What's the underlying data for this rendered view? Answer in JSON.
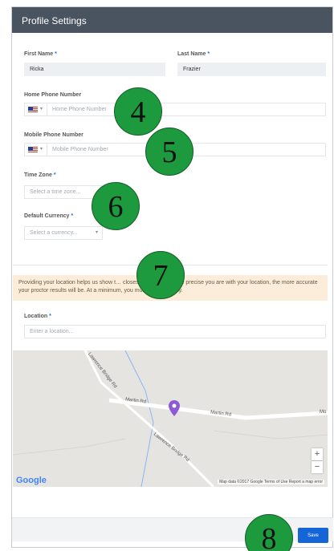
{
  "header": {
    "title": "Profile Settings"
  },
  "required_mark": "*",
  "form": {
    "first_name": {
      "label": "First Name",
      "value": "Ricka"
    },
    "last_name": {
      "label": "Last Name",
      "value": "Frazier"
    },
    "home_phone": {
      "label": "Home Phone Number",
      "placeholder": "Home Phone Number"
    },
    "mobile_phone": {
      "label": "Mobile Phone Number",
      "placeholder": "Mobile Phone Number"
    },
    "time_zone": {
      "label": "Time Zone",
      "placeholder": "Select a time zone..."
    },
    "currency": {
      "label": "Default Currency",
      "placeholder": "Select a currency..."
    },
    "notice": "Providing your location helps us show t… closest to you. The more precise you are with your location, the more accurate your proctor results will be. At a minimum, you must provide a city.",
    "location": {
      "label": "Location",
      "placeholder": "Enter a location..."
    }
  },
  "map": {
    "road_labels": [
      "Lawrence Bridge Rd",
      "Martin Rd",
      "Martin Rd",
      "Lawrence Bridge Rd",
      "Mo"
    ],
    "google_logo": "Google",
    "credits": "Map data ©2017 Google   Terms of Use   Report a map error",
    "zoom_in": "+",
    "zoom_out": "−"
  },
  "footer": {
    "save_label": "Save"
  },
  "callouts": [
    "4",
    "5",
    "6",
    "7",
    "8"
  ],
  "colors": {
    "header": "#4a5461",
    "primary": "#1565d8",
    "notice": "#fbedd9",
    "callout": "#1e9a3e",
    "pin": "#8e5bd6"
  }
}
